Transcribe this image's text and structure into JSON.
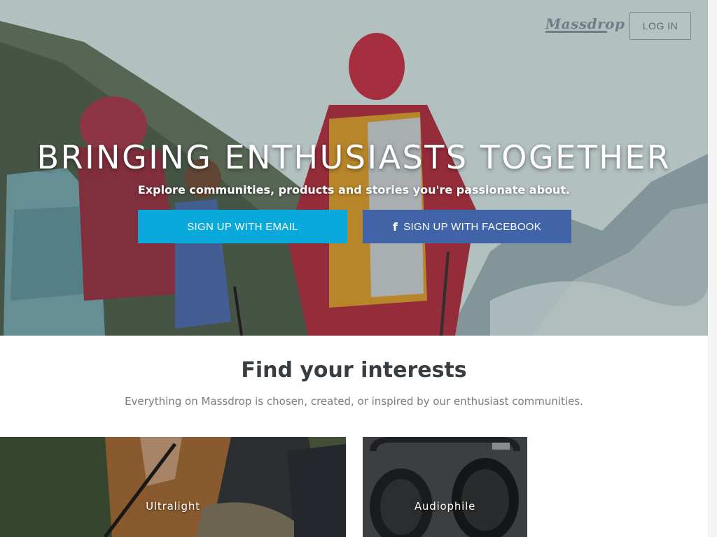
{
  "header": {
    "logo_text": "Massdrop",
    "login_label": "LOG IN"
  },
  "hero": {
    "title": "BRINGING ENTHUSIASTS TOGETHER",
    "subtitle": "Explore communities, products and stories you're passionate about.",
    "signup_email_label": "SIGN UP WITH EMAIL",
    "signup_facebook_label": "SIGN UP WITH FACEBOOK",
    "facebook_icon": "facebook-icon",
    "colors": {
      "email_button": "#0aa9db",
      "facebook_button": "#4163a8"
    }
  },
  "interests": {
    "title": "Find your interests",
    "subtitle": "Everything on Massdrop is chosen, created, or inspired by our enthusiast communities.",
    "cards": [
      {
        "label": "Ultralight"
      },
      {
        "label": "Audiophile"
      }
    ]
  }
}
